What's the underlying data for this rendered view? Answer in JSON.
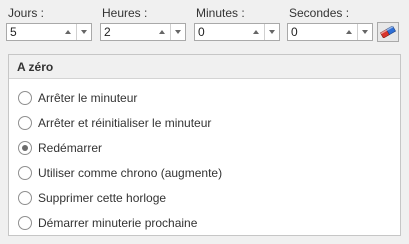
{
  "fields": [
    {
      "label": "Jours :",
      "value": "5"
    },
    {
      "label": "Heures :",
      "value": "2"
    },
    {
      "label": "Minutes :",
      "value": "0"
    },
    {
      "label": "Secondes :",
      "value": "0"
    }
  ],
  "toolbar": {
    "eraser_icon": "eraser-icon"
  },
  "group": {
    "title": "A zéro",
    "options": [
      {
        "label": "Arrêter le minuteur",
        "checked": false
      },
      {
        "label": "Arrêter et réinitialiser le minuteur",
        "checked": false
      },
      {
        "label": "Redémarrer",
        "checked": true
      },
      {
        "label": "Utiliser comme chrono (augmente)",
        "checked": false
      },
      {
        "label": "Supprimer cette horloge",
        "checked": false
      },
      {
        "label": "Démarrer minuterie prochaine",
        "checked": false
      }
    ]
  }
}
